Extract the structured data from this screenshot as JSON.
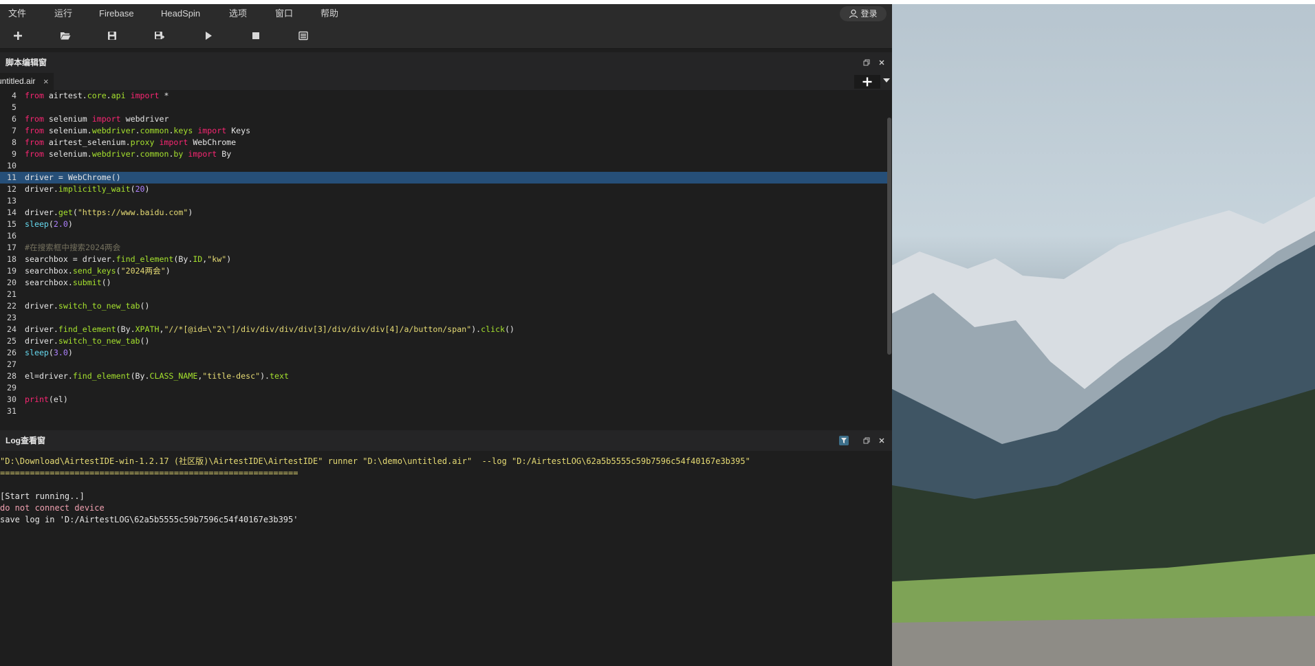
{
  "menu": {
    "items": [
      "文件",
      "运行",
      "Firebase",
      "HeadSpin",
      "选项",
      "窗口",
      "帮助"
    ],
    "login_label": "登录"
  },
  "toolbar": {
    "buttons": [
      "new-file-icon",
      "open-folder-icon",
      "save-icon",
      "save-as-icon",
      "run-icon",
      "stop-icon",
      "log-icon"
    ]
  },
  "editor_panel": {
    "title": "脚本编辑窗",
    "tab_label": "untitled.air",
    "tab_close": "×"
  },
  "code": {
    "line_numbers": [
      "4",
      "5",
      "6",
      "7",
      "8",
      "9",
      "10",
      "11",
      "12",
      "13",
      "14",
      "15",
      "16",
      "17",
      "18",
      "19",
      "20",
      "21",
      "22",
      "23",
      "24",
      "25",
      "26",
      "27",
      "28",
      "29",
      "30",
      "31"
    ]
  },
  "log_panel": {
    "title": "Log查看窗",
    "lines": [
      "\"D:\\Download\\AirtestIDE-win-1.2.17 (社区版)\\AirtestIDE\\AirtestIDE\" runner \"D:\\demo\\untitled.air\"  --log \"D:/AirtestLOG\\62a5b5555c59b7596c54f40167e3b395\"",
      "============================================================",
      "",
      "[Start running..]",
      "do not connect device",
      "save log in 'D:/AirtestLOG\\62a5b5555c59b7596c54f40167e3b395'"
    ]
  },
  "colors": {
    "keyword": "#f92672",
    "method": "#a6e22e",
    "string": "#e6db74",
    "number": "#ae81ff",
    "builtin": "#66d9ef",
    "comment": "#75715e",
    "selection": "#264f78"
  }
}
